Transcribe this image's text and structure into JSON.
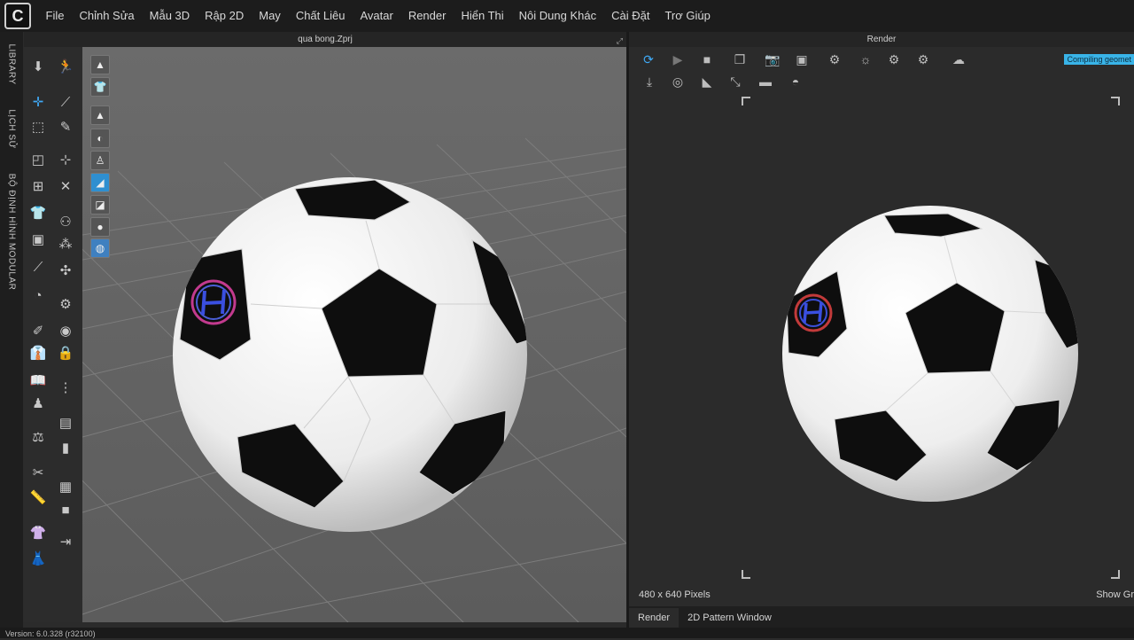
{
  "menu": {
    "logo": "C",
    "items": [
      "File",
      "Chỉnh Sửa",
      "Mẫu 3D",
      "Rập 2D",
      "May",
      "Chất Liêu",
      "Avatar",
      "Render",
      "Hiển Thi",
      "Nôi Dung Khác",
      "Cài Đặt",
      "Trơ Giúp"
    ]
  },
  "side_tabs": [
    "LIBRARY",
    "LỊCH SỬ",
    "BỘ ĐỊNH HÌNH MODULAR"
  ],
  "viewport3d": {
    "title": "qua bong.Zprj"
  },
  "render": {
    "title": "Render",
    "status_chip": "Compiling geomet",
    "size_label": "480 x 640 Pixels",
    "show_grid_label": "Show Gr",
    "tabs": [
      "Render",
      "2D Pattern Window"
    ]
  },
  "status": {
    "version": "Version: 6.0.328 (r32100)"
  },
  "icons": {
    "toolbar_left": [
      "select-arrow-icon",
      "walk-icon",
      "move-icon",
      "brush-icon",
      "rect-select-icon",
      "needle-icon",
      "fold-icon",
      "pin-icon",
      "transform-icon",
      "tape-icon",
      "shirt-icon",
      "button-icon",
      "pen-icon",
      "hanger-icon",
      "magnet-icon",
      "zipper-icon"
    ],
    "viewport": [
      "avatar-view-icon",
      "garment-view-icon",
      "fabric-view-icon",
      "texture-view-icon",
      "body-view-icon",
      "surface-view-icon",
      "shade-view-icon",
      "head-view-icon",
      "globe-view-icon"
    ],
    "render_row1": [
      "render-start-icon",
      "render-video-icon",
      "render-stop-icon",
      "copy-image-icon",
      "camera-icon",
      "save-image-icon",
      "image-settings-icon",
      "light-settings-icon",
      "camera-settings-icon",
      "render-settings-icon",
      "cloud-render-icon"
    ],
    "render_row2": [
      "download-icon",
      "sphere-icon",
      "spotlight-icon",
      "direction-light-icon",
      "cylinder-icon",
      "dome-icon"
    ]
  },
  "colors": {
    "accent": "#39b4e8",
    "panel": "#2b2b2b",
    "viewport": "#666666"
  }
}
